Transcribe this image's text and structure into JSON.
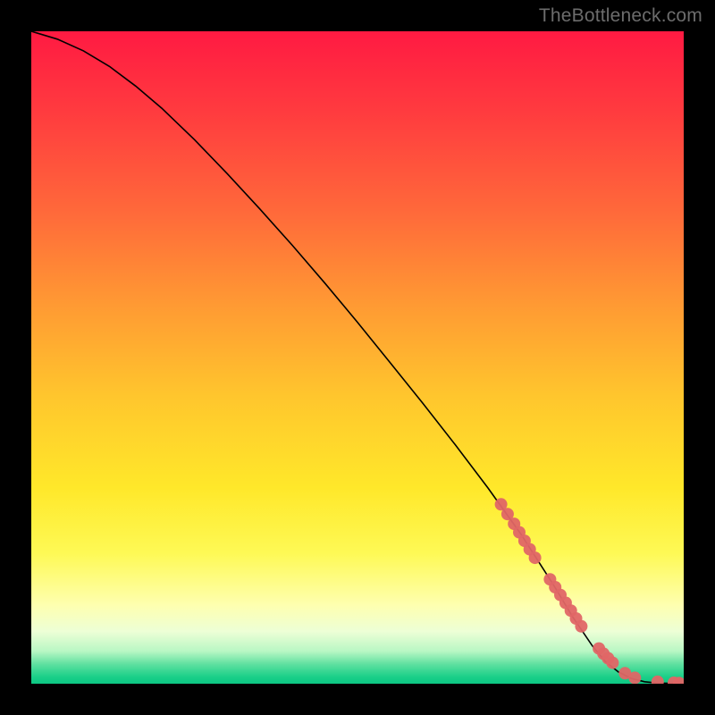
{
  "watermark": "TheBottleneck.com",
  "chart_data": {
    "type": "line",
    "title": "",
    "xlabel": "",
    "ylabel": "",
    "xlim": [
      0,
      100
    ],
    "ylim": [
      0,
      100
    ],
    "grid": false,
    "legend": false,
    "series": [
      {
        "name": "curve",
        "x": [
          0,
          4,
          8,
          12,
          16,
          20,
          25,
          30,
          35,
          40,
          45,
          50,
          55,
          60,
          65,
          70,
          75,
          80,
          83,
          86,
          88,
          90,
          92,
          94,
          96,
          98,
          100
        ],
        "y": [
          100,
          98.8,
          97.0,
          94.6,
          91.6,
          88.2,
          83.4,
          78.2,
          72.8,
          67.2,
          61.4,
          55.4,
          49.2,
          43.0,
          36.6,
          30.0,
          23.0,
          15.2,
          10.2,
          5.8,
          3.4,
          1.8,
          0.8,
          0.3,
          0.1,
          0.05,
          0
        ]
      }
    ],
    "scatter_points": {
      "name": "highlighted-dots",
      "x": [
        72,
        73,
        74,
        74.8,
        75.6,
        76.4,
        77.2,
        79.5,
        80.3,
        81.1,
        81.9,
        82.7,
        83.5,
        84.3,
        87.0,
        87.7,
        88.4,
        89.1,
        91.0,
        92.5,
        96.0,
        98.5,
        99.3
      ],
      "y": [
        27.5,
        26.0,
        24.5,
        23.2,
        21.9,
        20.6,
        19.3,
        16.0,
        14.8,
        13.6,
        12.4,
        11.2,
        10.0,
        8.8,
        5.4,
        4.6,
        3.9,
        3.2,
        1.6,
        0.9,
        0.3,
        0.15,
        0.1
      ]
    },
    "background_gradient": {
      "top": "#ff1a42",
      "upper_mid": "#ff9a33",
      "mid": "#ffe82a",
      "lower_mid": "#feffb0",
      "bottom": "#0dc884"
    }
  }
}
